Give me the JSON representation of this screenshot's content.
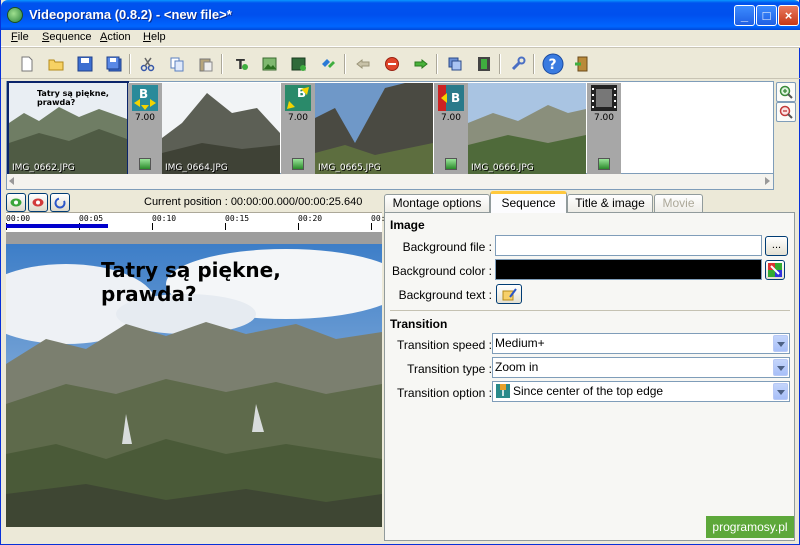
{
  "window": {
    "title": "Videoporama (0.8.2) - <new file>*"
  },
  "menu": {
    "items": [
      {
        "u": "F",
        "rest": "ile"
      },
      {
        "u": "S",
        "rest": "equence"
      },
      {
        "u": "A",
        "rest": "ction"
      },
      {
        "u": "H",
        "rest": "elp"
      }
    ]
  },
  "toolbar": {
    "icons": [
      "new-file-icon",
      "open-folder-icon",
      "save-icon",
      "save-all-icon",
      "cut-icon",
      "copy-icon",
      "paste-icon",
      "add-title-icon",
      "add-image-icon",
      "add-color-icon",
      "add-transition-icon",
      "move-left-icon",
      "remove-icon",
      "move-right-icon",
      "duplicate-icon",
      "render-movie-icon",
      "settings-wrench-icon",
      "help-icon",
      "exit-icon"
    ]
  },
  "strip": {
    "thumbs": [
      {
        "caption": "IMG_0662.JPG",
        "overlay": "Tatry są piękne, prawda?"
      },
      {
        "caption": "IMG_0664.JPG"
      },
      {
        "caption": "IMG_0665.JPG"
      },
      {
        "caption": "IMG_0666.JPG"
      }
    ],
    "transitions": [
      {
        "value": "7.00",
        "icon": "transition-b-arrows-icon"
      },
      {
        "value": "7.00",
        "icon": "transition-b-diagonal-icon"
      },
      {
        "value": "7.00",
        "icon": "transition-b-left-icon"
      },
      {
        "value": "7.00",
        "icon": "film-icon"
      }
    ]
  },
  "preview": {
    "current_position": "Current position : 00:00:00.000/00:00:25.640",
    "ruler": [
      "00:00",
      "00:05",
      "00:10",
      "00:15",
      "00:20",
      "00:"
    ],
    "caption": "Tatry są piękne, prawda?",
    "progress": 0.27
  },
  "tabs": [
    {
      "label": "Montage options",
      "state": "normal"
    },
    {
      "label": "Sequence",
      "state": "active"
    },
    {
      "label": "Title & image",
      "state": "normal"
    },
    {
      "label": "Movie",
      "state": "disabled"
    }
  ],
  "sequence": {
    "image_header": "Image",
    "bg_file_label": "Background file :",
    "bg_file_value": "",
    "browse_label": "...",
    "bg_color_label": "Background color :",
    "bg_color_value": "#000000",
    "bg_text_label": "Background text :",
    "transition_header": "Transition",
    "speed_label": "Transition speed :",
    "speed_value": "Medium+",
    "type_label": "Transition type :",
    "type_value": "Zoom in",
    "option_label": "Transition option :",
    "option_value": "Since center of the top edge"
  },
  "watermark": "programosy.pl"
}
